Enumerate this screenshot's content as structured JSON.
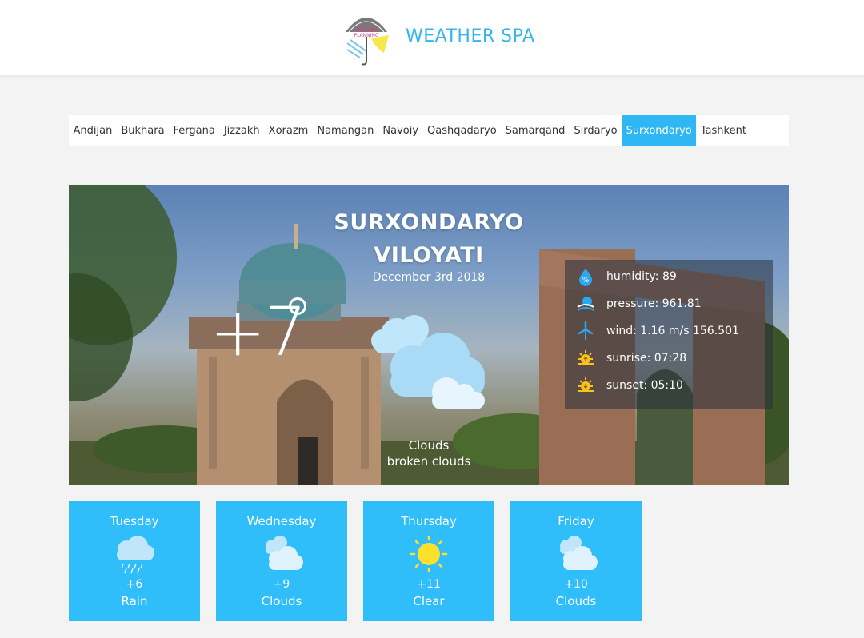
{
  "header": {
    "brand": "WEATHER SPA",
    "logo_text_line1": "WEATHER",
    "logo_text_line2": "PLANNING",
    "brand_color": "#33b5f0"
  },
  "tabs": [
    {
      "label": "Andijan",
      "active": false
    },
    {
      "label": "Bukhara",
      "active": false
    },
    {
      "label": "Fergana",
      "active": false
    },
    {
      "label": "Jizzakh",
      "active": false
    },
    {
      "label": "Xorazm",
      "active": false
    },
    {
      "label": "Namangan",
      "active": false
    },
    {
      "label": "Navoiy",
      "active": false
    },
    {
      "label": "Qashqadaryo",
      "active": false
    },
    {
      "label": "Samarqand",
      "active": false
    },
    {
      "label": "Sirdaryo",
      "active": false
    },
    {
      "label": "Surxondaryo",
      "active": true
    },
    {
      "label": "Tashkent",
      "active": false
    }
  ],
  "current": {
    "city_line1": "SURXONDARYO",
    "city_line2": "VILOYATI",
    "date": "December 3rd 2018",
    "temperature": "+7",
    "condition": "Clouds",
    "description": "broken clouds",
    "icon": "clouds-icon",
    "details": {
      "humidity": "humidity: 89",
      "pressure": "pressure: 961.81",
      "wind": "wind: 1.16 m/s 156.501",
      "sunrise": "sunrise: 07:28",
      "sunset": "sunset: 05:10"
    }
  },
  "forecast": [
    {
      "day": "Tuesday",
      "temp": "+6",
      "condition": "Rain",
      "icon": "rain-icon"
    },
    {
      "day": "Wednesday",
      "temp": "+9",
      "condition": "Clouds",
      "icon": "clouds-icon"
    },
    {
      "day": "Thursday",
      "temp": "+11",
      "condition": "Clear",
      "icon": "sun-icon"
    },
    {
      "day": "Friday",
      "temp": "+10",
      "condition": "Clouds",
      "icon": "clouds-icon"
    }
  ],
  "colors": {
    "accent": "#2fb6f5",
    "card": "#2fbef9",
    "background": "#f3f3f3"
  }
}
